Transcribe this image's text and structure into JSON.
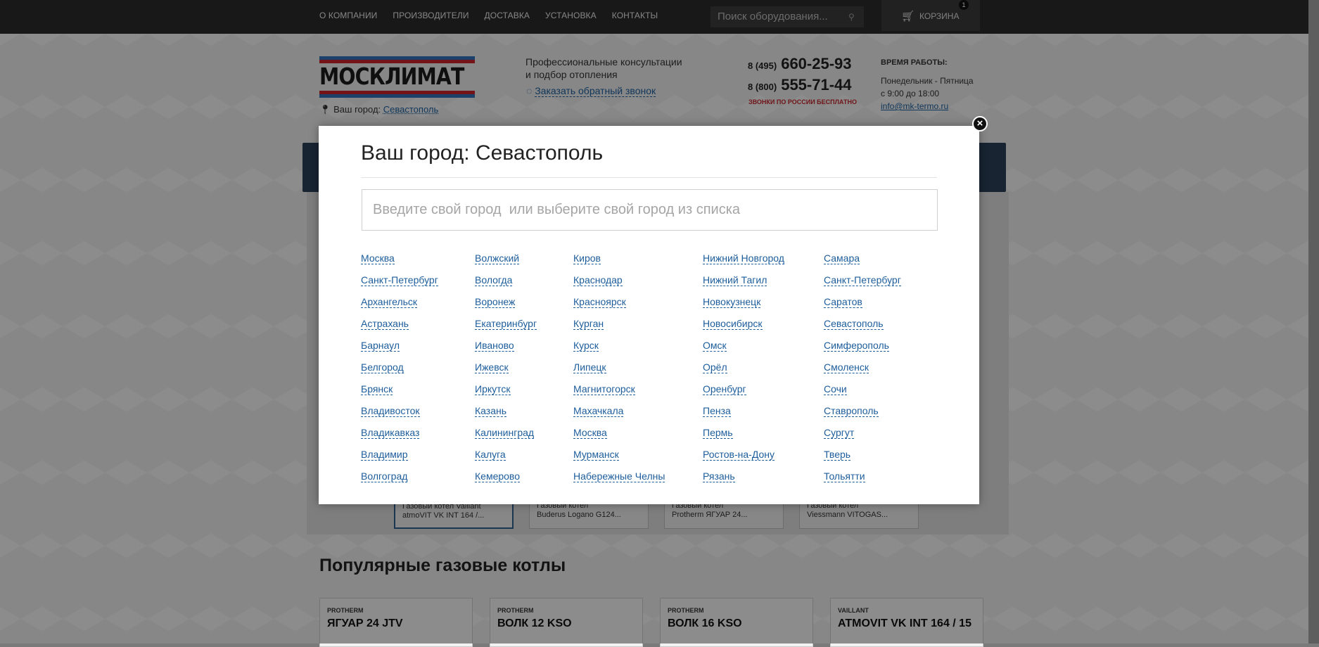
{
  "topnav": [
    "О КОМПАНИИ",
    "ПРОИЗВОДИТЕЛИ",
    "ДОСТАВКА",
    "УСТАНОВКА",
    "КОНТАКТЫ"
  ],
  "search": {
    "placeholder": "Поиск оборудования..."
  },
  "cart": {
    "label": "КОРЗИНА",
    "count": "1"
  },
  "logo": {
    "text": "МОСКЛИМАТ",
    "colors": [
      "#2f6fb5",
      "#c8232c"
    ]
  },
  "header": {
    "city_label": "Ваш город:",
    "city_value": "Севастополь",
    "consult_line1": "Профессиональные консультации",
    "consult_line2": "и подбор отопления",
    "callback": "Заказать обратный звонок",
    "phones": [
      {
        "code": "8 (495)",
        "number": "660-25-93"
      },
      {
        "code": "8 (800)",
        "number": "555-71-44"
      }
    ],
    "free_calls": "ЗВОНКИ ПО РОССИИ БЕСПЛАТНО",
    "hours_title": "ВРЕМЯ РАБОТЫ:",
    "hours_days": "Понедельник - Пятница",
    "hours_time": "с 9:00 до 18:00",
    "email": "info@mk-termo.ru"
  },
  "thumbs": [
    {
      "line1": "Газовый котел Vaillant",
      "line2": "atmoVIT VK INT 164 /..."
    },
    {
      "line1": "Газовый котел",
      "line2": "Buderus Logano G124..."
    },
    {
      "line1": "Газовый котел",
      "line2": "Protherm ЯГУАР 24..."
    },
    {
      "line1": "Газовый котел",
      "line2": "Viessmann VITOGAS..."
    }
  ],
  "popular": {
    "title": "Популярные газовые котлы",
    "cards": [
      {
        "brand": "PROTHERM",
        "model": "ЯГУАР 24 JTV"
      },
      {
        "brand": "PROTHERM",
        "model": "ВОЛК 12 KSO"
      },
      {
        "brand": "PROTHERM",
        "model": "ВОЛК 16 KSO"
      },
      {
        "brand": "VAILLANT",
        "model": "ATMOVIT VK INT 164 / 15"
      }
    ]
  },
  "modal": {
    "title": "Ваш город: Севастополь",
    "input_placeholder": "Введите свой город  или выберите свой город из списка",
    "close": "×",
    "columns": [
      [
        "Москва",
        "Санкт-Петербург",
        "Архангельск",
        "Астрахань",
        "Барнаул",
        "Белгород",
        "Брянск",
        "Владивосток",
        "Владикавказ",
        "Владимир",
        "Волгоград"
      ],
      [
        "Волжский",
        "Вологда",
        "Воронеж",
        "Екатеринбург",
        "Иваново",
        "Ижевск",
        "Иркутск",
        "Казань",
        "Калининград",
        "Калуга",
        "Кемерово"
      ],
      [
        "Киров",
        "Краснодар",
        "Красноярск",
        "Курган",
        "Курск",
        "Липецк",
        "Магнитогорск",
        "Махачкала",
        "Москва",
        "Мурманск",
        "Набережные Челны"
      ],
      [
        "Нижний Новгород",
        "Нижний Тагил",
        "Новокузнецк",
        "Новосибирск",
        "Омск",
        "Орёл",
        "Оренбург",
        "Пенза",
        "Пермь",
        "Ростов-на-Дону",
        "Рязань"
      ],
      [
        "Самара",
        "Санкт-Петербург",
        "Саратов",
        "Севастополь",
        "Симферополь",
        "Смоленск",
        "Сочи",
        "Ставрополь",
        "Сургут",
        "Тверь",
        "Тольятти"
      ]
    ]
  }
}
